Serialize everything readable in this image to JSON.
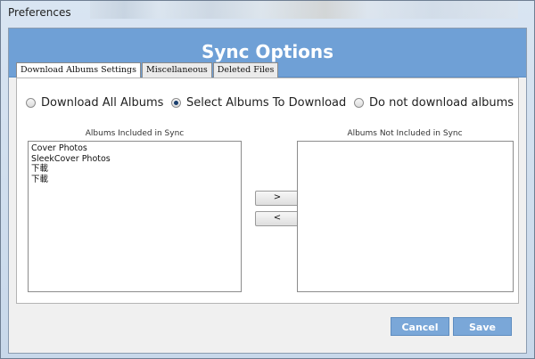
{
  "window": {
    "title": "Preferences"
  },
  "header": {
    "title": "Sync Options"
  },
  "tabs": [
    {
      "label": "Download Albums Settings",
      "active": true
    },
    {
      "label": "Miscellaneous",
      "active": false
    },
    {
      "label": "Deleted Files",
      "active": false
    }
  ],
  "radio_options": [
    {
      "label": "Download All Albums",
      "selected": false
    },
    {
      "label": "Select Albums To Download",
      "selected": true
    },
    {
      "label": "Do not download albums",
      "selected": false
    }
  ],
  "included": {
    "label": "Albums Included in Sync",
    "items": [
      "Cover Photos",
      "SleekCover Photos",
      "下載",
      "下載"
    ]
  },
  "excluded": {
    "label": "Albums Not Included in Sync",
    "items": []
  },
  "move_buttons": {
    "add": ">",
    "remove": "<"
  },
  "footer": {
    "cancel": "Cancel",
    "save": "Save"
  }
}
